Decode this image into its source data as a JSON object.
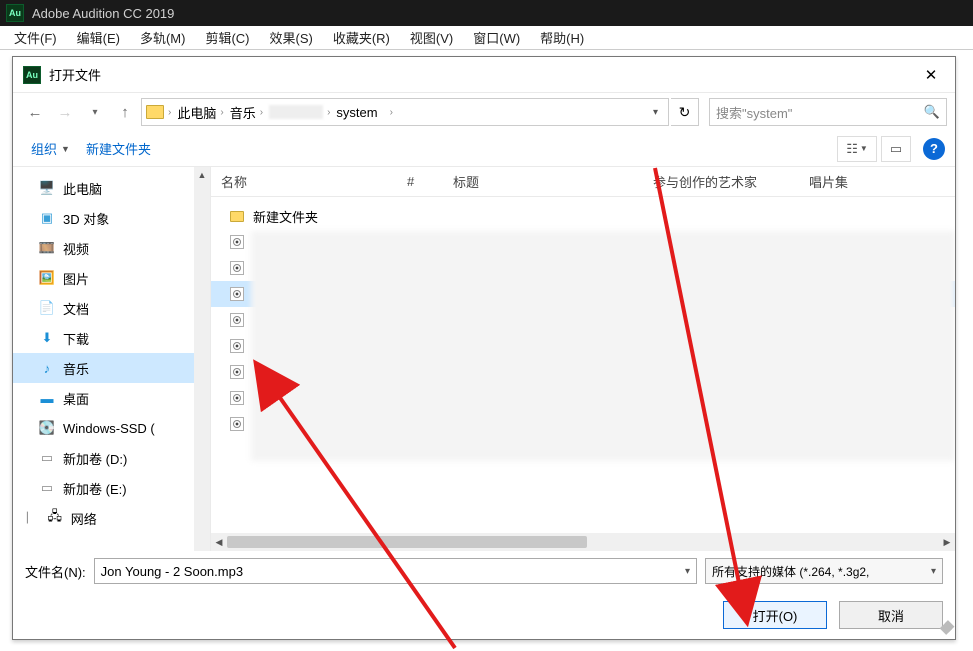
{
  "app": {
    "title": "Adobe Audition CC 2019",
    "icon_text": "Au"
  },
  "menubar": {
    "file": "文件(F)",
    "edit": "编辑(E)",
    "multitrack": "多轨(M)",
    "clip": "剪辑(C)",
    "effect": "效果(S)",
    "fav": "收藏夹(R)",
    "view": "视图(V)",
    "window": "窗口(W)",
    "help": "帮助(H)"
  },
  "dialog": {
    "title": "打开文件",
    "breadcrumb": {
      "root": "此电脑",
      "music": "音乐",
      "last": "system"
    },
    "search_placeholder": "搜索\"system\"",
    "toolbar": {
      "organize": "组织",
      "newfolder": "新建文件夹"
    },
    "help_glyph": "?",
    "columns": {
      "name": "名称",
      "num": "#",
      "title": "标题",
      "artist": "参与创作的艺术家",
      "album": "唱片集"
    },
    "folder_row": "新建文件夹",
    "filename_label": "文件名(N):",
    "filename_value": "Jon Young - 2 Soon.mp3",
    "filetype_value": "所有支持的媒体 (*.264, *.3g2,",
    "open_btn": "打开(O)",
    "cancel_btn": "取消"
  },
  "nav": {
    "this_pc": "此电脑",
    "objects3d": "3D 对象",
    "video": "视频",
    "pictures": "图片",
    "documents": "文档",
    "downloads": "下载",
    "music": "音乐",
    "desktop": "桌面",
    "winssd": "Windows-SSD (",
    "vol_d": "新加卷 (D:)",
    "vol_e": "新加卷 (E:)",
    "network": "网络"
  }
}
